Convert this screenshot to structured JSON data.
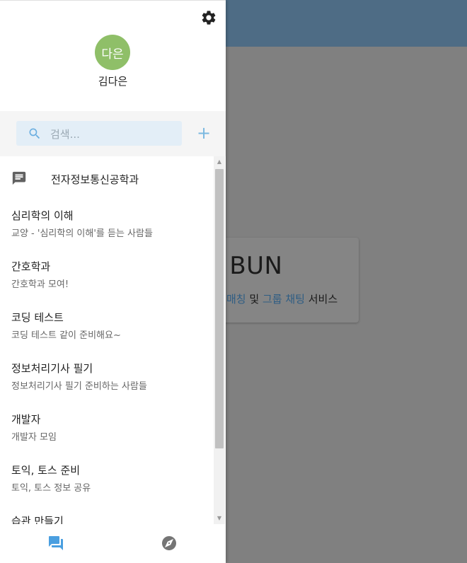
{
  "background": {
    "card_title": "& BUN",
    "card_sub_1": "매칭",
    "card_sub_2": "및",
    "card_sub_3": "그룹 채팅",
    "card_sub_4": "서비스"
  },
  "drawer": {
    "settings_icon": "gear-icon",
    "avatar_text": "다은",
    "username": "김다은",
    "search": {
      "placeholder": "검색..."
    },
    "add_icon": "+",
    "category": {
      "label": "전자정보통신공학과",
      "icon": "chat-icon"
    },
    "rooms": [
      {
        "title": "심리학의 이해",
        "subtitle": "교양 - '심리학의 이해'를 듣는 사람들"
      },
      {
        "title": "간호학과",
        "subtitle": "간호학과 모여!"
      },
      {
        "title": "코딩 테스트",
        "subtitle": "코딩 테스트 같이 준비해요~"
      },
      {
        "title": "정보처리기사 필기",
        "subtitle": "정보처리기사 필기 준비하는 사람들"
      },
      {
        "title": "개발자",
        "subtitle": "개발자 모임"
      },
      {
        "title": "토익, 토스 준비",
        "subtitle": "토익, 토스 정보 공유"
      },
      {
        "title": "습관 만들기",
        "subtitle": ""
      }
    ],
    "bottom_nav": [
      {
        "name": "chats",
        "icon": "forum-icon",
        "color": "#4a9fe0"
      },
      {
        "name": "explore",
        "icon": "compass-icon",
        "color": "#757575"
      }
    ]
  },
  "colors": {
    "header_bg": "#4e6c85",
    "overlay_bg": "#808080",
    "avatar_bg": "#8fbf68",
    "accent": "#4a9fe0",
    "search_bg": "#e3eef7"
  }
}
